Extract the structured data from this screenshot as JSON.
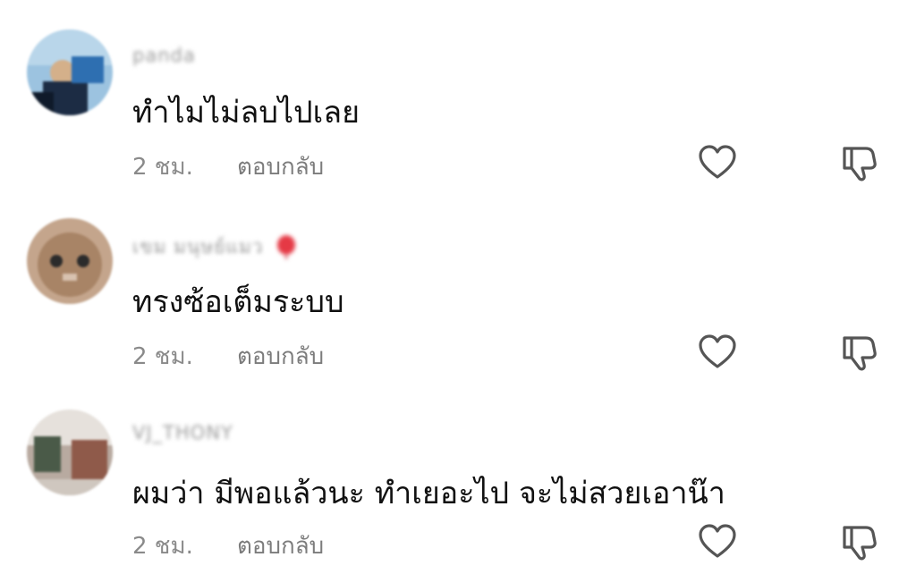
{
  "comments": [
    {
      "username": "panda",
      "text": "ทำไมไม่ลบไปเลย",
      "time": "2 ชม.",
      "reply_label": "ตอบกลับ",
      "has_balloon": false,
      "avatar_icon": "avatar"
    },
    {
      "username": "เขม มนุษย์แมว",
      "text": "ทรงซ้อเต็มระบบ",
      "time": "2 ชม.",
      "reply_label": "ตอบกลับ",
      "has_balloon": true,
      "avatar_icon": "avatar"
    },
    {
      "username": "VJ_THONY",
      "text": "ผมว่า มีพอแล้วนะ ทำเยอะไป จะไม่สวยเอาน๊า",
      "time": "2 ชม.",
      "reply_label": "ตอบกลับ",
      "has_balloon": false,
      "avatar_icon": "avatar"
    }
  ],
  "colors": {
    "text": "#111111",
    "meta": "#8a8a8a",
    "icon": "#555555",
    "balloon": "#e53945"
  },
  "icons": {
    "like": "heart-icon",
    "dislike": "thumbs-down-icon",
    "balloon": "balloon-icon"
  }
}
